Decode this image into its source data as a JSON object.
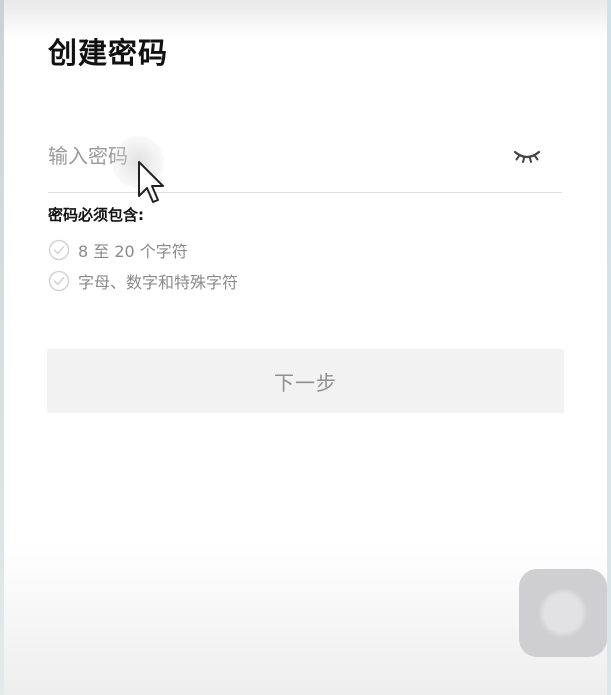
{
  "page": {
    "title": "创建密码"
  },
  "password": {
    "placeholder": "输入密码",
    "value": "",
    "visibility_icon": "eye-closed-icon"
  },
  "requirements": {
    "heading": "密码必须包含:",
    "items": [
      {
        "label": "8 至 20 个字符",
        "icon": "check-circle-icon",
        "met": false
      },
      {
        "label": "字母、数字和特殊字符",
        "icon": "check-circle-icon",
        "met": false
      }
    ]
  },
  "actions": {
    "next_label": "下一步",
    "next_enabled": false
  },
  "colors": {
    "title": "#111111",
    "placeholder": "#9a9a9a",
    "muted": "#8a8a8a",
    "button_bg_disabled": "#f2f2f2",
    "button_text_disabled": "#8f8f8f"
  }
}
